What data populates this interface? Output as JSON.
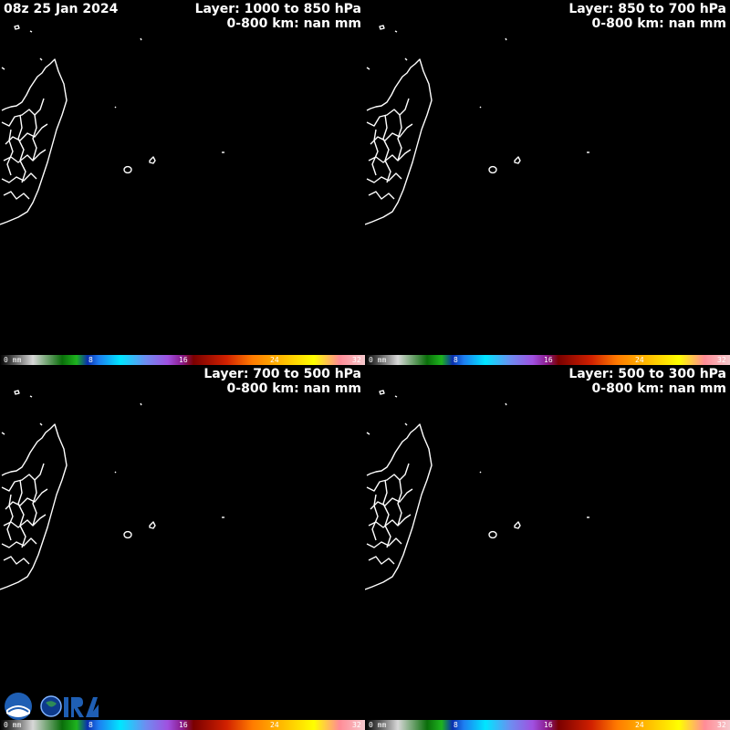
{
  "date_label": "08z 25 Jan 2024",
  "accum_label": "0-800 km: nan mm",
  "panels": [
    {
      "layer": "Layer: 1000 to 850 hPa"
    },
    {
      "layer": "Layer: 850 to 700 hPa"
    },
    {
      "layer": "Layer: 700 to 500 hPa"
    },
    {
      "layer": "Layer: 500 to 300 hPa"
    }
  ],
  "colorbar": {
    "unit": "mm",
    "ticks": [
      "0 mm",
      "8",
      "16",
      "24",
      "32"
    ]
  },
  "colors": {
    "background": "#000000",
    "coastline": "#ffffff"
  },
  "logos": {
    "agency_left": "NOAA",
    "agency_right": "CIRA"
  }
}
